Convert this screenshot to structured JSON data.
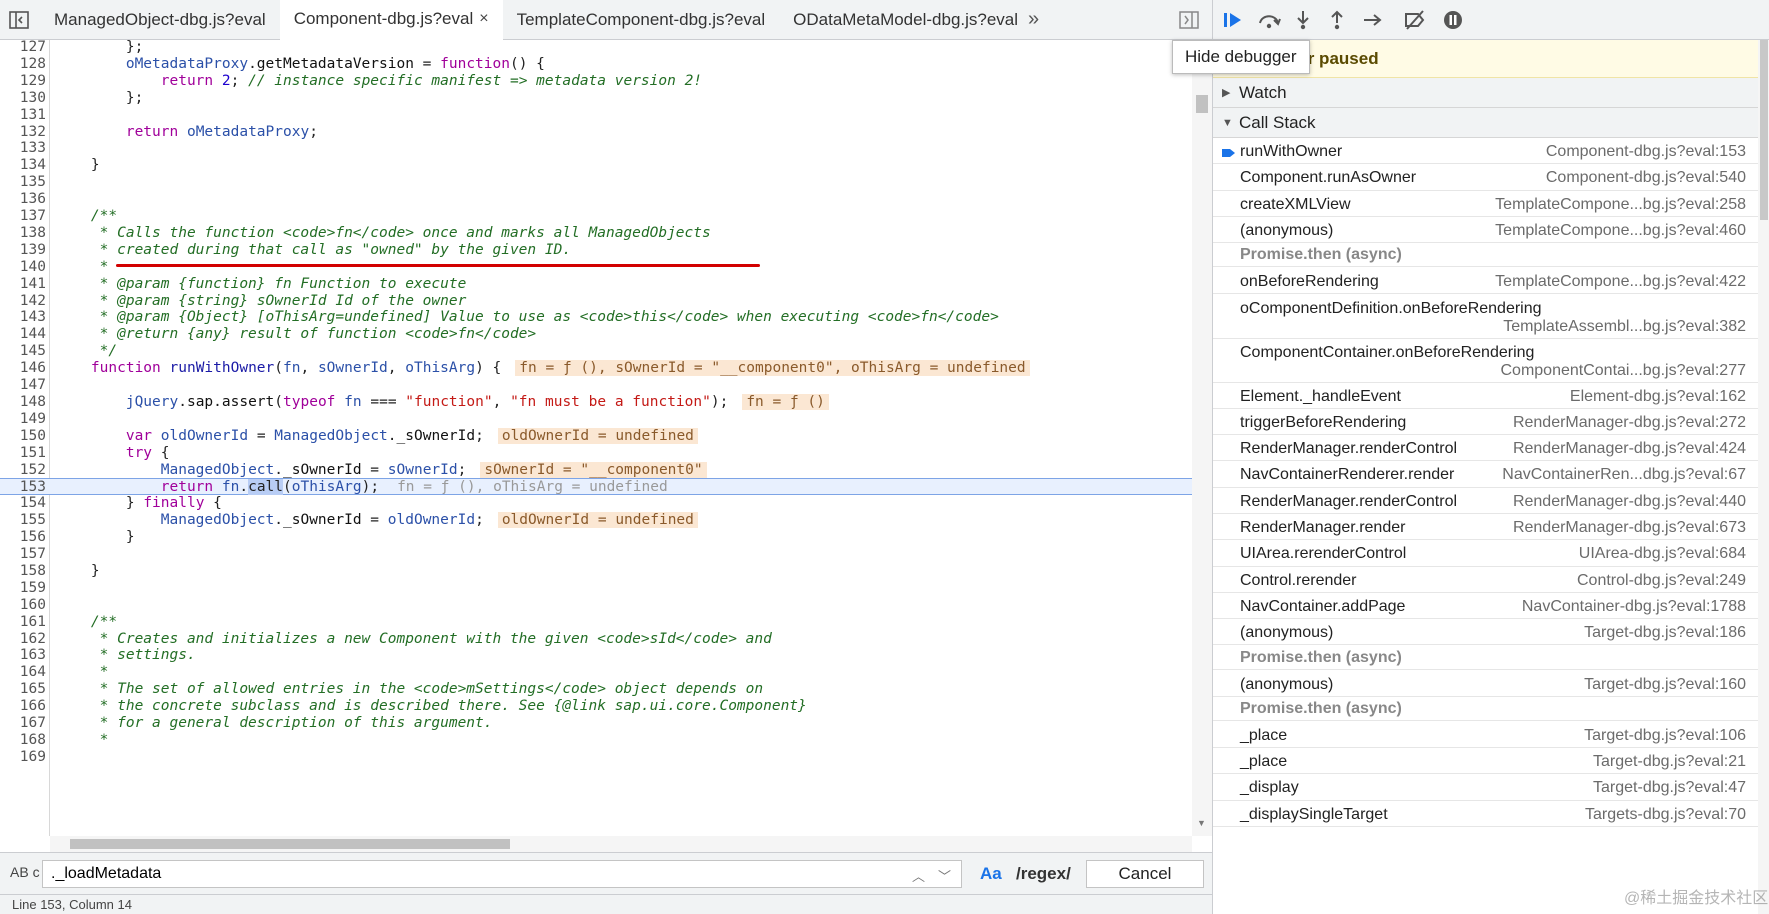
{
  "tabs": [
    {
      "label": "ManagedObject-dbg.js?eval",
      "active": false
    },
    {
      "label": "Component-dbg.js?eval",
      "active": true
    },
    {
      "label": "TemplateComponent-dbg.js?eval",
      "active": false
    },
    {
      "label": "ODataMetaModel-dbg.js?eval",
      "active": false
    }
  ],
  "tab_more": "»",
  "tab_close": "×",
  "code_lines": [
    {
      "n": "127",
      "html": "        };"
    },
    {
      "n": "128",
      "html": "        <span class='var'>oMetadataProxy</span>.<span class='prop'>getMetadataVersion</span> = <span class='kw'>function</span>() {"
    },
    {
      "n": "129",
      "html": "            <span class='kw'>return</span> <span class='num'>2</span>; <span class='cmt'>// instance specific manifest =&gt; metadata version 2!</span>"
    },
    {
      "n": "130",
      "html": "        };"
    },
    {
      "n": "131",
      "html": ""
    },
    {
      "n": "132",
      "html": "        <span class='kw'>return</span> <span class='var'>oMetadataProxy</span>;"
    },
    {
      "n": "133",
      "html": ""
    },
    {
      "n": "134",
      "html": "    }"
    },
    {
      "n": "135",
      "html": ""
    },
    {
      "n": "136",
      "html": ""
    },
    {
      "n": "137",
      "html": "    <span class='cmt'>/**</span>"
    },
    {
      "n": "138",
      "html": "<span class='cmt'>     * Calls the function &lt;code&gt;fn&lt;/code&gt; once and marks all ManagedObjects</span>"
    },
    {
      "n": "139",
      "html": "<span class='cmt'>     * created during that call as \"owned\" by the given ID.</span>"
    },
    {
      "n": "140",
      "html": "<span class='cmt'>     *</span>"
    },
    {
      "n": "141",
      "html": "<span class='cmt'>     * @param {function} fn Function to execute</span>"
    },
    {
      "n": "142",
      "html": "<span class='cmt'>     * @param {string} sOwnerId Id of the owner</span>"
    },
    {
      "n": "143",
      "html": "<span class='cmt'>     * @param {Object} [oThisArg=undefined] Value to use as &lt;code&gt;this&lt;/code&gt; when executing &lt;code&gt;fn&lt;/code&gt;</span>"
    },
    {
      "n": "144",
      "html": "<span class='cmt'>     * @return {any} result of function &lt;code&gt;fn&lt;/code&gt;</span>"
    },
    {
      "n": "145",
      "html": "<span class='cmt'>     */</span>"
    },
    {
      "n": "146",
      "html": "    <span class='kw'>function</span> <span class='fn'>runWithOwner</span>(<span class='var'>fn</span>, <span class='var'>sOwnerId</span>, <span class='var'>oThisArg</span>) {<span class='inline-val'>fn = ƒ (), sOwnerId = \"__component0\", oThisArg = undefined</span>"
    },
    {
      "n": "147",
      "html": ""
    },
    {
      "n": "148",
      "html": "        <span class='var'>jQuery</span>.<span class='prop'>sap</span>.<span class='prop'>assert</span>(<span class='kw'>typeof</span> <span class='var'>fn</span> === <span class='str'>\"function\"</span>, <span class='str'>\"fn must be a function\"</span>);<span class='inline-val'>fn = ƒ ()</span>"
    },
    {
      "n": "149",
      "html": ""
    },
    {
      "n": "150",
      "html": "        <span class='kw'>var</span> <span class='var'>oldOwnerId</span> = <span class='var'>ManagedObject</span>.<span class='prop'>_sOwnerId</span>;<span class='inline-val'>oldOwnerId = undefined</span>"
    },
    {
      "n": "151",
      "html": "        <span class='kw'>try</span> {"
    },
    {
      "n": "152",
      "html": "            <span class='var'>ManagedObject</span>.<span class='prop'>_sOwnerId</span> = <span class='var'>sOwnerId</span>;<span class='inline-val'>sOwnerId = \"__component0\"</span>"
    },
    {
      "n": "153",
      "html": "            <span class='kw'>return</span> <span class='var'>fn</span>.<span class='sel'>call</span>(<span class='var'>oThisArg</span>);<span class='inline-val muted'>fn = ƒ (), oThisArg = undefined</span>"
    },
    {
      "n": "154",
      "html": "        } <span class='kw'>finally</span> {"
    },
    {
      "n": "155",
      "html": "            <span class='var'>ManagedObject</span>.<span class='prop'>_sOwnerId</span> = <span class='var'>oldOwnerId</span>;<span class='inline-val'>oldOwnerId = undefined</span>"
    },
    {
      "n": "156",
      "html": "        }"
    },
    {
      "n": "157",
      "html": ""
    },
    {
      "n": "158",
      "html": "    }"
    },
    {
      "n": "159",
      "html": ""
    },
    {
      "n": "160",
      "html": ""
    },
    {
      "n": "161",
      "html": "    <span class='cmt'>/**</span>"
    },
    {
      "n": "162",
      "html": "<span class='cmt'>     * Creates and initializes a new Component with the given &lt;code&gt;sId&lt;/code&gt; and</span>"
    },
    {
      "n": "163",
      "html": "<span class='cmt'>     * settings.</span>"
    },
    {
      "n": "164",
      "html": "<span class='cmt'>     *</span>"
    },
    {
      "n": "165",
      "html": "<span class='cmt'>     * The set of allowed entries in the &lt;code&gt;mSettings&lt;/code&gt; object depends on</span>"
    },
    {
      "n": "166",
      "html": "<span class='cmt'>     * the concrete subclass and is described there. See {@link sap.ui.core.Component}</span>"
    },
    {
      "n": "167",
      "html": "<span class='cmt'>     * for a general description of this argument.</span>"
    },
    {
      "n": "168",
      "html": "<span class='cmt'>     *</span>"
    },
    {
      "n": "169",
      "html": ""
    }
  ],
  "search": {
    "case_label": "AB c",
    "value": "._loadMetadata",
    "match_case_label": "Aa",
    "regex_label": "/regex/",
    "cancel_label": "Cancel"
  },
  "status_bar": "Line 153, Column 14",
  "tooltip": "Hide debugger",
  "paused_banner": "Debugger paused",
  "watch_label": "Watch",
  "call_stack_label": "Call Stack",
  "frames": [
    {
      "kind": "frame",
      "name": "runWithOwner",
      "loc": "Component-dbg.js?eval:153",
      "current": true
    },
    {
      "kind": "frame",
      "name": "Component.runAsOwner",
      "loc": "Component-dbg.js?eval:540"
    },
    {
      "kind": "frame",
      "name": "createXMLView",
      "loc": "TemplateCompone...bg.js?eval:258"
    },
    {
      "kind": "frame",
      "name": "(anonymous)",
      "loc": "TemplateCompone...bg.js?eval:460"
    },
    {
      "kind": "async",
      "name": "Promise.then (async)"
    },
    {
      "kind": "frame",
      "name": "onBeforeRendering",
      "loc": "TemplateCompone...bg.js?eval:422"
    },
    {
      "kind": "frame2",
      "name": "oComponentDefinition.onBeforeRendering",
      "loc": "TemplateAssembl...bg.js?eval:382"
    },
    {
      "kind": "frame2",
      "name": "ComponentContainer.onBeforeRendering",
      "loc": "ComponentContai...bg.js?eval:277"
    },
    {
      "kind": "frame",
      "name": "Element._handleEvent",
      "loc": "Element-dbg.js?eval:162"
    },
    {
      "kind": "frame",
      "name": "triggerBeforeRendering",
      "loc": "RenderManager-dbg.js?eval:272"
    },
    {
      "kind": "frame",
      "name": "RenderManager.renderControl",
      "loc": "RenderManager-dbg.js?eval:424"
    },
    {
      "kind": "frame",
      "name": "NavContainerRenderer.render",
      "loc": "NavContainerRen...dbg.js?eval:67"
    },
    {
      "kind": "frame",
      "name": "RenderManager.renderControl",
      "loc": "RenderManager-dbg.js?eval:440"
    },
    {
      "kind": "frame",
      "name": "RenderManager.render",
      "loc": "RenderManager-dbg.js?eval:673"
    },
    {
      "kind": "frame",
      "name": "UIArea.rerenderControl",
      "loc": "UIArea-dbg.js?eval:684"
    },
    {
      "kind": "frame",
      "name": "Control.rerender",
      "loc": "Control-dbg.js?eval:249"
    },
    {
      "kind": "frame",
      "name": "NavContainer.addPage",
      "loc": "NavContainer-dbg.js?eval:1788"
    },
    {
      "kind": "frame",
      "name": "(anonymous)",
      "loc": "Target-dbg.js?eval:186"
    },
    {
      "kind": "async",
      "name": "Promise.then (async)"
    },
    {
      "kind": "frame",
      "name": "(anonymous)",
      "loc": "Target-dbg.js?eval:160"
    },
    {
      "kind": "async",
      "name": "Promise.then (async)"
    },
    {
      "kind": "frame",
      "name": "_place",
      "loc": "Target-dbg.js?eval:106"
    },
    {
      "kind": "frame",
      "name": "_place",
      "loc": "Target-dbg.js?eval:21"
    },
    {
      "kind": "frame",
      "name": "_display",
      "loc": "Target-dbg.js?eval:47"
    },
    {
      "kind": "frame",
      "name": "_displaySingleTarget",
      "loc": "Targets-dbg.js?eval:70"
    }
  ],
  "watermark": "@稀土掘金技术社区",
  "colors": {
    "accent": "#1a73e8",
    "paused_bg": "#fffbe5",
    "underline": "#d20000"
  }
}
